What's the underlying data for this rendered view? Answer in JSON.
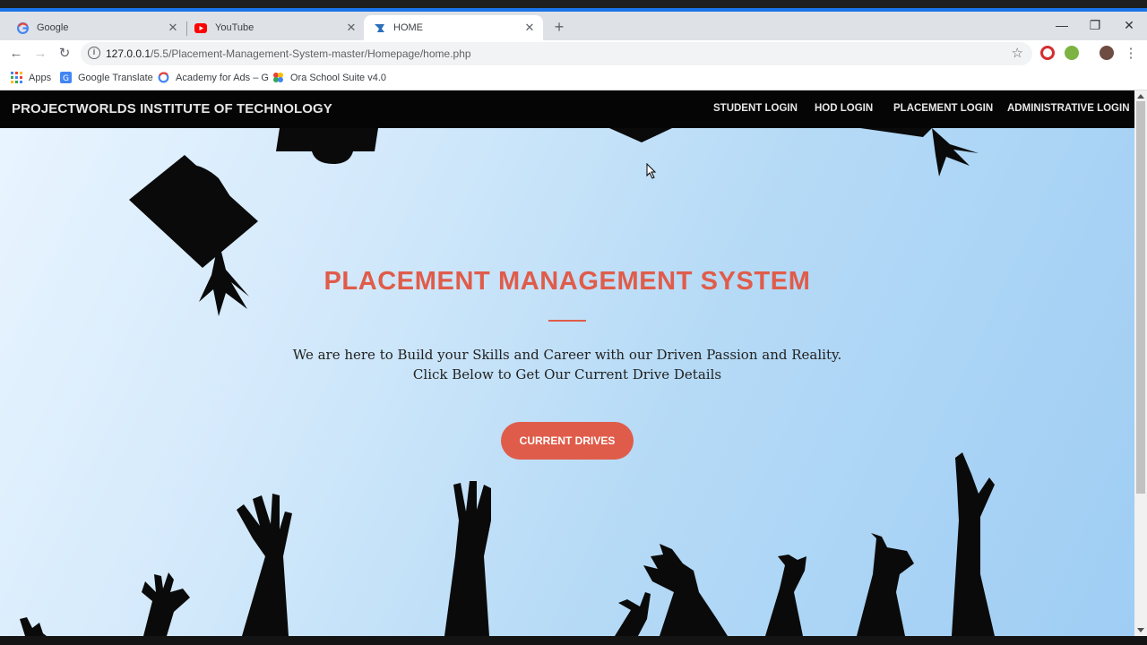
{
  "browser": {
    "tabs": [
      {
        "title": "Google",
        "icon": "google-icon"
      },
      {
        "title": "YouTube",
        "icon": "youtube-icon"
      },
      {
        "title": "HOME",
        "icon": "site-favicon-icon",
        "active": true
      }
    ],
    "url_host": "127.0.0.1",
    "url_path": "/5.5/Placement-Management-System-master/Homepage/home.php",
    "bookmarks": [
      {
        "label": "Apps",
        "icon": "apps-grid-icon"
      },
      {
        "label": "Google Translate",
        "icon": "translate-icon"
      },
      {
        "label": "Academy for Ads – G",
        "icon": "google-icon"
      },
      {
        "label": "Ora School Suite v4.0",
        "icon": "ora-icon"
      }
    ]
  },
  "site": {
    "brand": "PROJECTWORLDS INSTITUTE OF TECHNOLOGY",
    "nav": [
      "STUDENT LOGIN",
      "HOD LOGIN",
      "PLACEMENT LOGIN",
      "ADMINISTRATIVE LOGIN"
    ]
  },
  "hero": {
    "title": "PLACEMENT MANAGEMENT SYSTEM",
    "line1": "We are here to Build your Skills and Career with our Driven Passion and Reality.",
    "line2": "Click Below to Get Our Current Drive Details",
    "button": "CURRENT DRIVES"
  },
  "colors": {
    "accent": "#e05c4a",
    "navbar": "#050505",
    "chrome_blue": "#1a73e8"
  }
}
